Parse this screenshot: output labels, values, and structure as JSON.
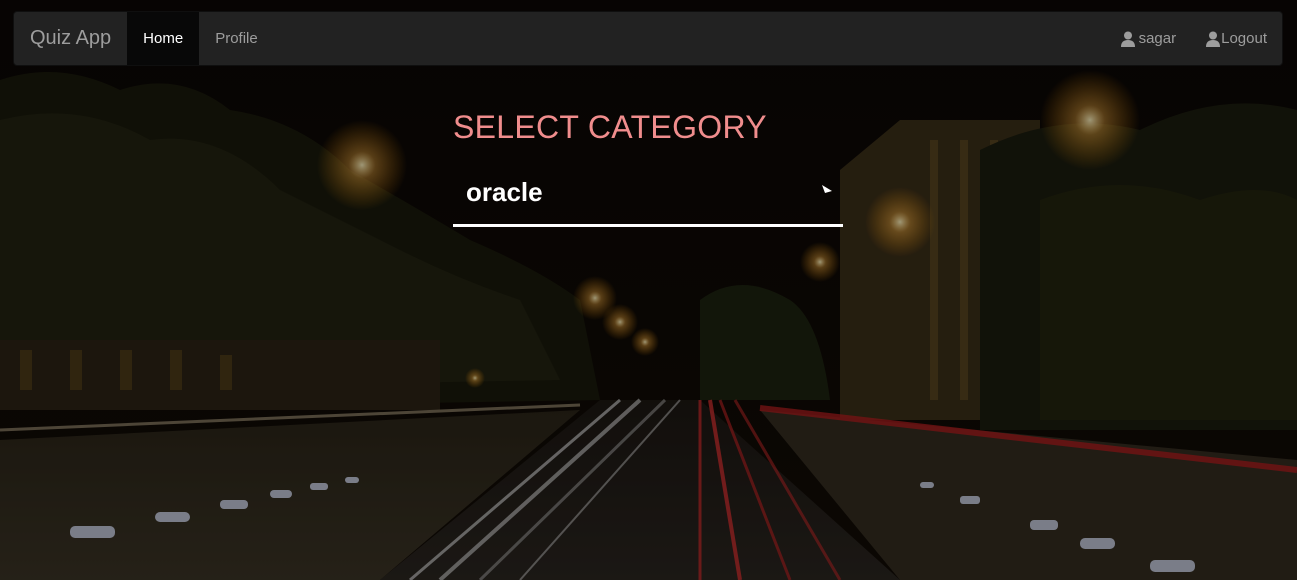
{
  "navbar": {
    "brand": "Quiz App",
    "links": [
      {
        "label": "Home",
        "active": true
      },
      {
        "label": "Profile",
        "active": false
      }
    ],
    "user": {
      "label": "sagar",
      "icon": "user-icon"
    },
    "logout": {
      "label": "Logout",
      "icon": "user-icon"
    }
  },
  "category": {
    "heading": "SELECT CATEGORY",
    "selected": "oracle",
    "arrow_icon": "dropdown-arrow-icon"
  },
  "colors": {
    "navbar_bg": "#222222",
    "active_link_bg": "#080808",
    "heading": "#f08d8d",
    "select_text": "#ffffff"
  }
}
